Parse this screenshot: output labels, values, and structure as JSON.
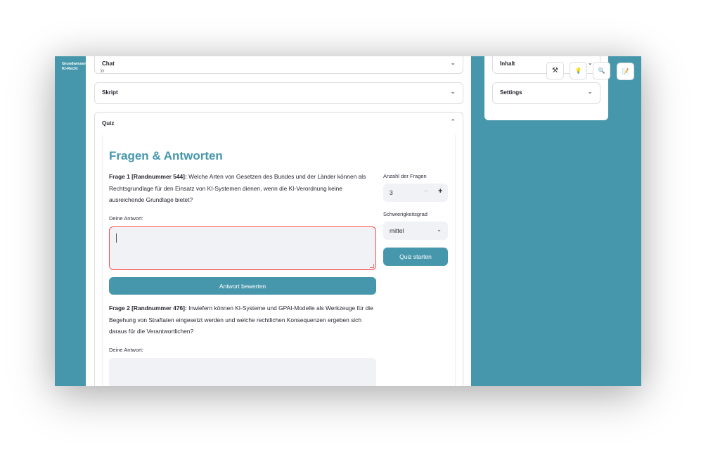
{
  "brand": {
    "line1": "Grundwissen",
    "line2": "KI-Recht"
  },
  "sidebar": {
    "collapse_icon": "double-chevron-right-icon",
    "collapse_glyph": "»"
  },
  "expanders": {
    "chat": {
      "label": "Chat",
      "state": "collapsed"
    },
    "skript": {
      "label": "Skript",
      "state": "collapsed"
    },
    "quiz": {
      "label": "Quiz",
      "state": "expanded"
    }
  },
  "quiz": {
    "title": "Fragen & Antworten",
    "questions": [
      {
        "prefix": "Frage 1 [Randnummer 544]:",
        "text": " Welche Arten von Gesetzen des Bundes und der Länder können als Rechtsgrundlage für den Einsatz von KI-Systemen dienen, wenn die KI-Verordnung keine ausreichende Grundlage bietet?",
        "answer_label": "Deine Antwort:",
        "answer_value": ""
      },
      {
        "prefix": "Frage 2 [Randnummer 476]:",
        "text": " Inwiefern können KI-Systeme und GPAI-Modelle als Werkzeuge für die Begehung von Straftaten eingesetzt werden und welche rechtlichen Konsequenzen ergeben sich daraus für die Verantwortlichen?",
        "answer_label": "Deine Antwort:",
        "answer_value": ""
      }
    ],
    "evaluate_button": "Antwort bewerten",
    "settings": {
      "count_label": "Anzahl der Fragen",
      "count_value": "3",
      "minus": "−",
      "plus": "+",
      "difficulty_label": "Schwierigkeitsgrad",
      "difficulty_value": "mittel",
      "start_button": "Quiz starten"
    }
  },
  "right_panel": {
    "inhalt": {
      "label": "Inhalt",
      "state": "collapsed"
    },
    "settings": {
      "label": "Settings",
      "state": "collapsed"
    }
  },
  "toolbar": {
    "tools": [
      {
        "icon": "tools-icon",
        "glyph": "⚒"
      },
      {
        "icon": "lightbulb-icon",
        "glyph": "💡"
      },
      {
        "icon": "search-icon",
        "glyph": "🔍"
      },
      {
        "icon": "notes-icon",
        "glyph": "📝"
      }
    ]
  },
  "colors": {
    "accent": "#4797ac",
    "error_border": "#ff4b4b",
    "input_bg": "#f0f2f6"
  }
}
